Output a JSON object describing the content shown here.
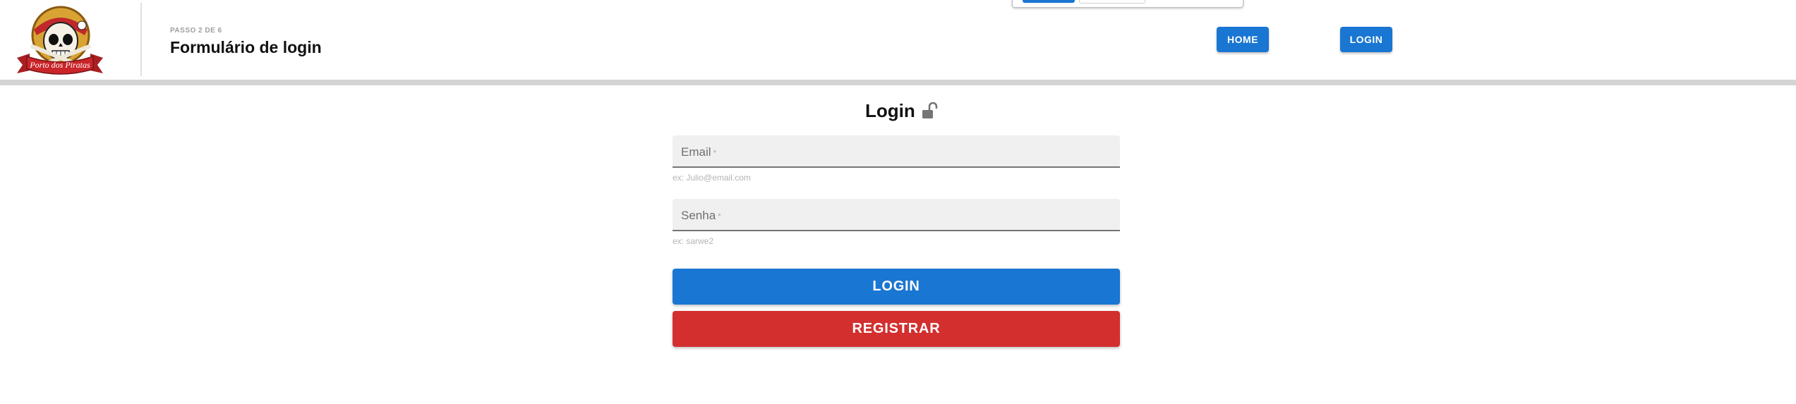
{
  "header": {
    "logo_text": "Porto dos Piratas",
    "step": "PASSO 2 DE 6",
    "title": "Formulário de login",
    "nav": [
      {
        "label": "HOME"
      },
      {
        "label": "LOGIN"
      }
    ]
  },
  "form": {
    "title": "Login",
    "fields": {
      "email": {
        "label": "Email",
        "required_mark": "*",
        "value": "",
        "hint": "ex: Julio@email.com"
      },
      "senha": {
        "label": "Senha",
        "required_mark": "*",
        "value": "",
        "hint": "ex: sarwe2"
      }
    },
    "login_label": "LOGIN",
    "register_label": "REGISTRAR"
  },
  "colors": {
    "primary": "#1976d2",
    "danger": "#d32f2f",
    "divider": "#d4d4d4",
    "field_bg": "#f0f0f0"
  },
  "icons": {
    "title_icon": "lock-open-icon",
    "logo": "pirate-skull-logo"
  }
}
